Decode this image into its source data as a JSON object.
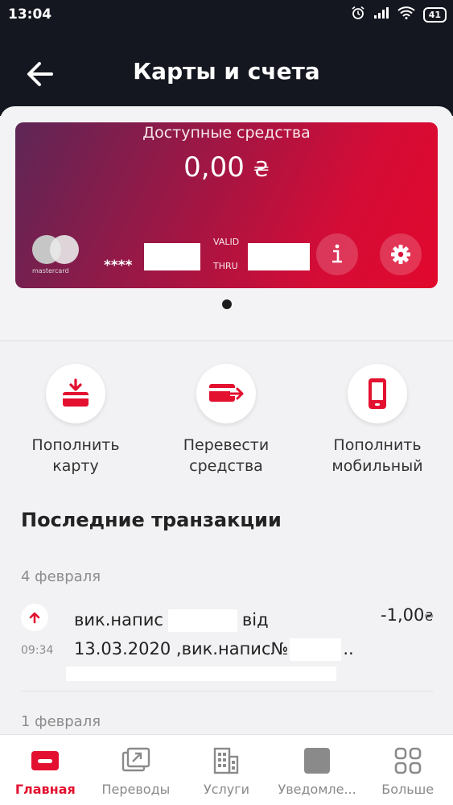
{
  "status_bar": {
    "time": "13:04",
    "battery": "41"
  },
  "header": {
    "title": "Карты и счета"
  },
  "card": {
    "available_label": "Доступные средства",
    "amount": "0,00",
    "currency_symbol": "₴",
    "brand_caption": "mastercard",
    "masked_number": "****",
    "valid_label": "VALID",
    "thru_label": "THRU"
  },
  "actions": [
    {
      "line1": "Пополнить",
      "line2": "карту"
    },
    {
      "line1": "Перевести",
      "line2": "средства"
    },
    {
      "line1": "Пополнить",
      "line2": "мобильный"
    }
  ],
  "transactions": {
    "title": "Последние транзакции",
    "groups": [
      {
        "date": "4 февраля",
        "items": [
          {
            "time": "09:34",
            "desc_a": "вик.напис",
            "desc_b": "від",
            "desc_line2": "13.03.2020 ,вик.напис№",
            "desc_ellipsis": "..",
            "amount": "-1,00",
            "currency": "₴"
          }
        ]
      },
      {
        "date": "1 февраля",
        "items": []
      }
    ]
  },
  "tabbar": [
    {
      "label": "Главная",
      "active": true
    },
    {
      "label": "Переводы"
    },
    {
      "label": "Услуги"
    },
    {
      "label": "Уведомле..."
    },
    {
      "label": "Больше"
    }
  ],
  "colors": {
    "accent": "#e3102f",
    "header_bg": "#14171f",
    "card_gradient_start": "#5d2656",
    "card_gradient_end": "#e2082d"
  },
  "icons": [
    "arrow-left-icon",
    "info-icon",
    "gear-icon",
    "card-topup-icon",
    "card-transfer-icon",
    "phone-icon",
    "arrow-up-icon",
    "card-icon",
    "transfer-icon",
    "building-icon",
    "notification-icon",
    "grid-icon"
  ]
}
